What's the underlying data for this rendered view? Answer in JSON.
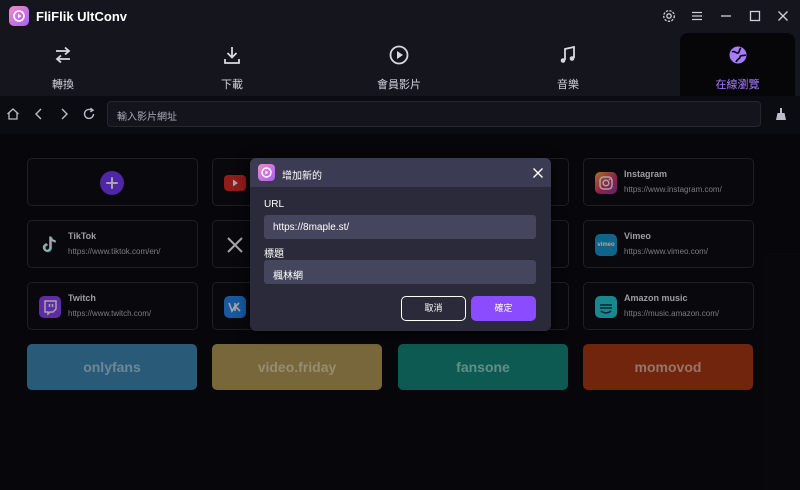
{
  "app": {
    "title": "FliFlik UltConv"
  },
  "nav": {
    "tabs": [
      {
        "label": "轉換",
        "icon": "convert-arrows-icon"
      },
      {
        "label": "下載",
        "icon": "download-icon"
      },
      {
        "label": "會員影片",
        "icon": "play-circle-icon"
      },
      {
        "label": "音樂",
        "icon": "music-note-icon"
      },
      {
        "label": "在線瀏覽",
        "icon": "globe-icon",
        "active": true
      }
    ]
  },
  "toolbar": {
    "url_placeholder": "輸入影片網址"
  },
  "sites": [
    {
      "name": "Instagram",
      "url": "https://www.instagram.com/",
      "icon": "instagram-icon"
    },
    {
      "name": "TikTok",
      "url": "https://www.tiktok.com/en/",
      "icon": "tiktok-icon"
    },
    {
      "name": "Vimeo",
      "url": "https://www.vimeo.com/",
      "icon": "vimeo-icon"
    },
    {
      "name": "Twitch",
      "url": "https://www.twitch.com/",
      "icon": "twitch-icon"
    },
    {
      "name": "Amazon music",
      "url": "https://music.amazon.com/",
      "icon": "amazon-music-icon"
    }
  ],
  "partially_hidden_icons": [
    "youtube-icon",
    "x-icon",
    "vk-icon"
  ],
  "vimeo_icon_text": "vimeo",
  "promo_buttons": [
    {
      "label": "onlyfans",
      "color": "#3f8bb8"
    },
    {
      "label": "video.friday",
      "color": "#b89f5a"
    },
    {
      "label": "fansone",
      "color": "#158a80"
    },
    {
      "label": "momovod",
      "color": "#b03a15"
    }
  ],
  "dialog": {
    "title": "增加新的",
    "url_label": "URL",
    "url_value": "https://8maple.st/",
    "title_label": "標題",
    "title_value": "楓林網",
    "cancel_label": "取消",
    "confirm_label": "確定"
  },
  "colors": {
    "accent": "#8b4bff",
    "active_tab_text": "#a97bff"
  }
}
